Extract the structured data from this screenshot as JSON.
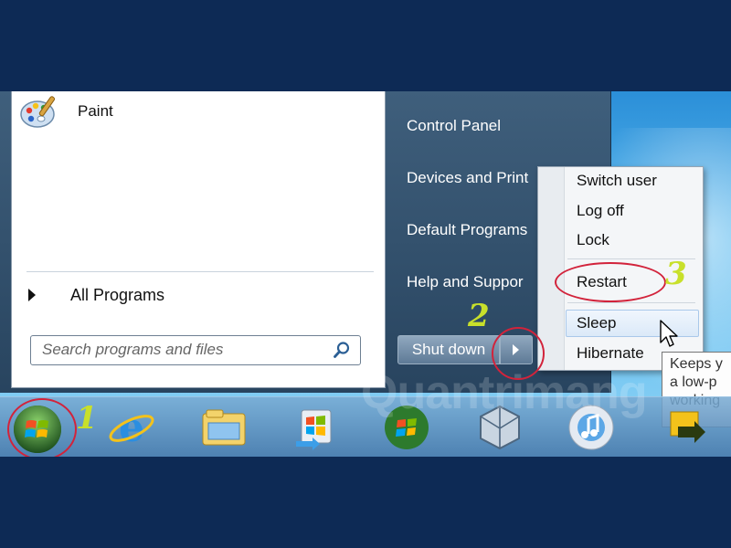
{
  "start_menu": {
    "pinned": [
      {
        "label": "Paint",
        "icon": "paint-palette-icon"
      }
    ],
    "all_programs_label": "All Programs",
    "search": {
      "placeholder": "Search programs and files",
      "value": ""
    },
    "right_items": [
      {
        "label": "Control Panel"
      },
      {
        "label": "Devices and Print"
      },
      {
        "label": "Default Programs"
      },
      {
        "label": "Help and Suppor"
      }
    ],
    "shutdown_label": "Shut down"
  },
  "power_menu": {
    "items": [
      {
        "label": "Switch user"
      },
      {
        "label": "Log off"
      },
      {
        "label": "Lock"
      },
      {
        "label": "Restart"
      },
      {
        "label": "Sleep"
      },
      {
        "label": "Hibernate"
      }
    ],
    "hovered": "Sleep"
  },
  "tooltip": {
    "lines": [
      "Keeps y",
      "a low-p",
      "working"
    ]
  },
  "annotations": {
    "step1": "1",
    "step2": "2",
    "step3": "3",
    "ring_color": "#d2233b",
    "number_color": "#c8e02b"
  },
  "taskbar": {
    "icons": [
      "start-orb-icon",
      "internet-explorer-icon",
      "windows-explorer-icon",
      "windows-update-icon",
      "windows-media-center-icon",
      "virtualbox-icon",
      "itunes-icon",
      "folder-sync-icon"
    ]
  },
  "watermark": "Quantrimang"
}
